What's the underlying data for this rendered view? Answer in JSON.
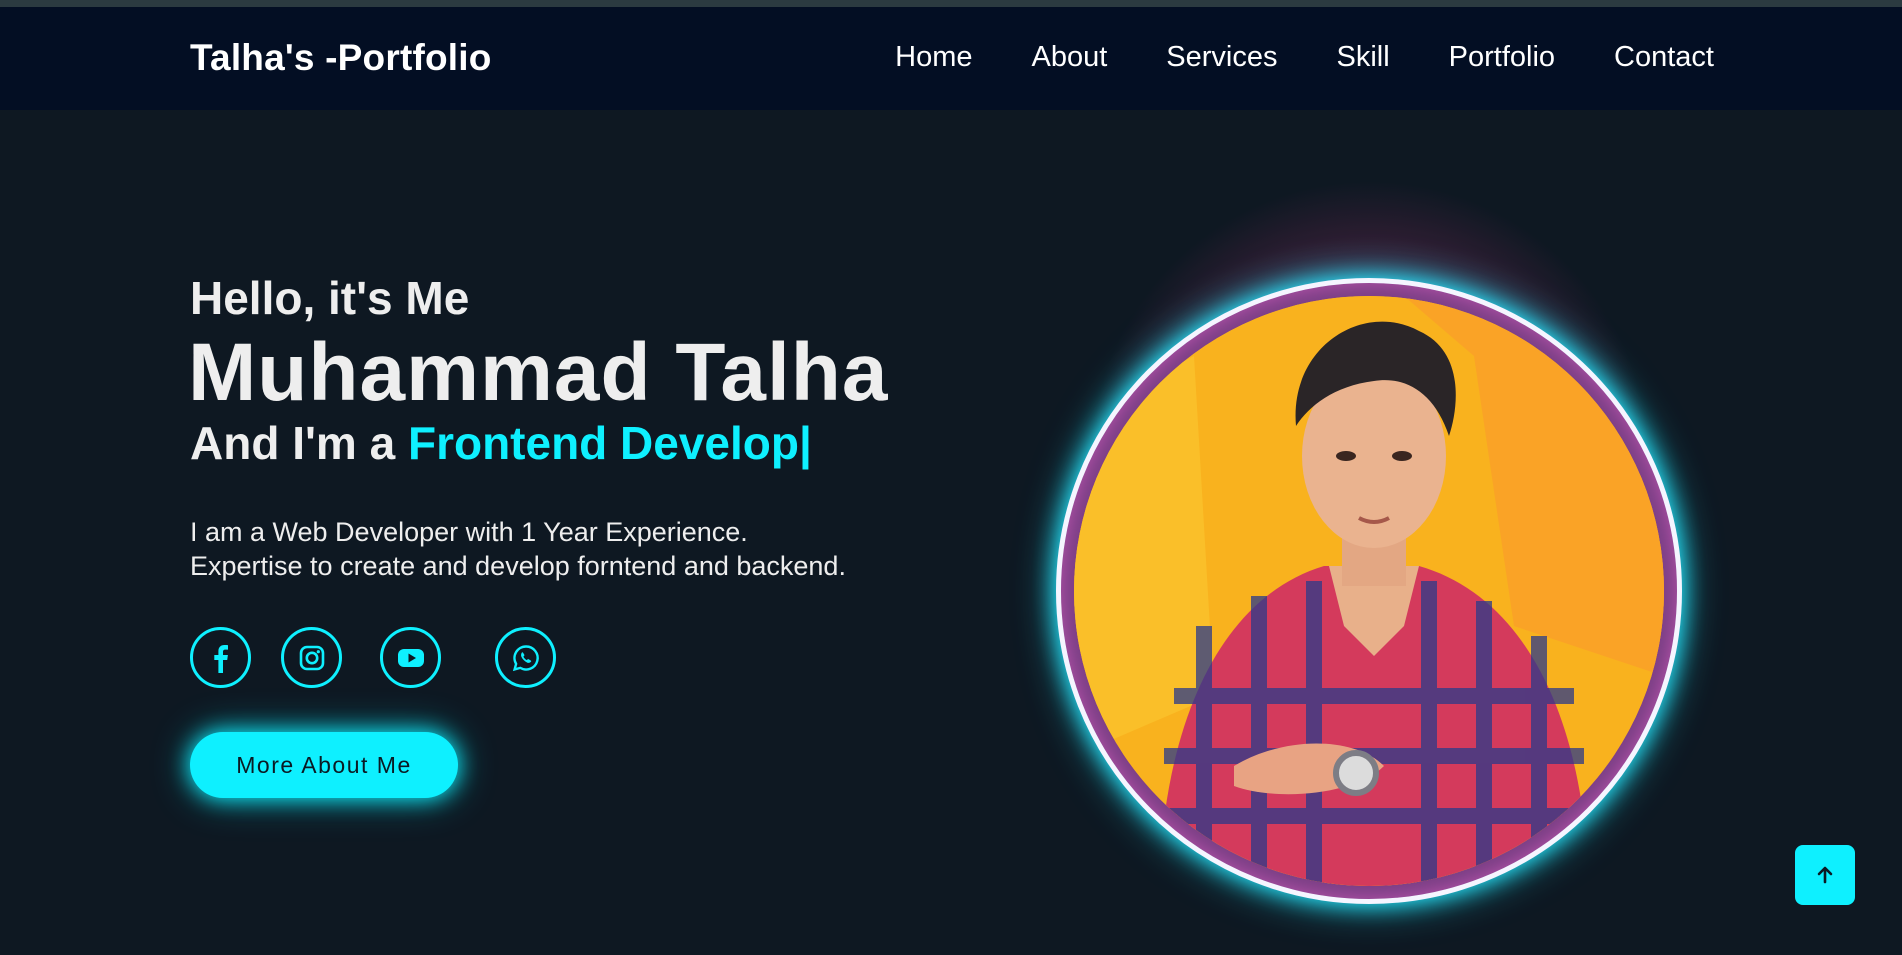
{
  "header": {
    "logo": "Talha's -Portfolio",
    "nav": [
      "Home",
      "About",
      "Services",
      "Skill",
      "Portfolio",
      "Contact"
    ]
  },
  "hero": {
    "greeting": "Hello, it's Me",
    "name": "Muhammad Talha",
    "role_prefix": "And I'm a ",
    "role_typed": "Frontend Develop|",
    "description_line1": "I am a Web Developer with 1 Year Experience.",
    "description_line2": "Expertise to create and develop forntend and backend.",
    "socials": [
      "facebook-icon",
      "instagram-icon",
      "youtube-icon",
      "whatsapp-icon"
    ],
    "button_label": "More About Me"
  },
  "colors": {
    "accent": "#0ef0ff",
    "background": "#0e1822",
    "header_bg": "#030e23"
  },
  "scroll_top_icon": "arrow-up-icon"
}
